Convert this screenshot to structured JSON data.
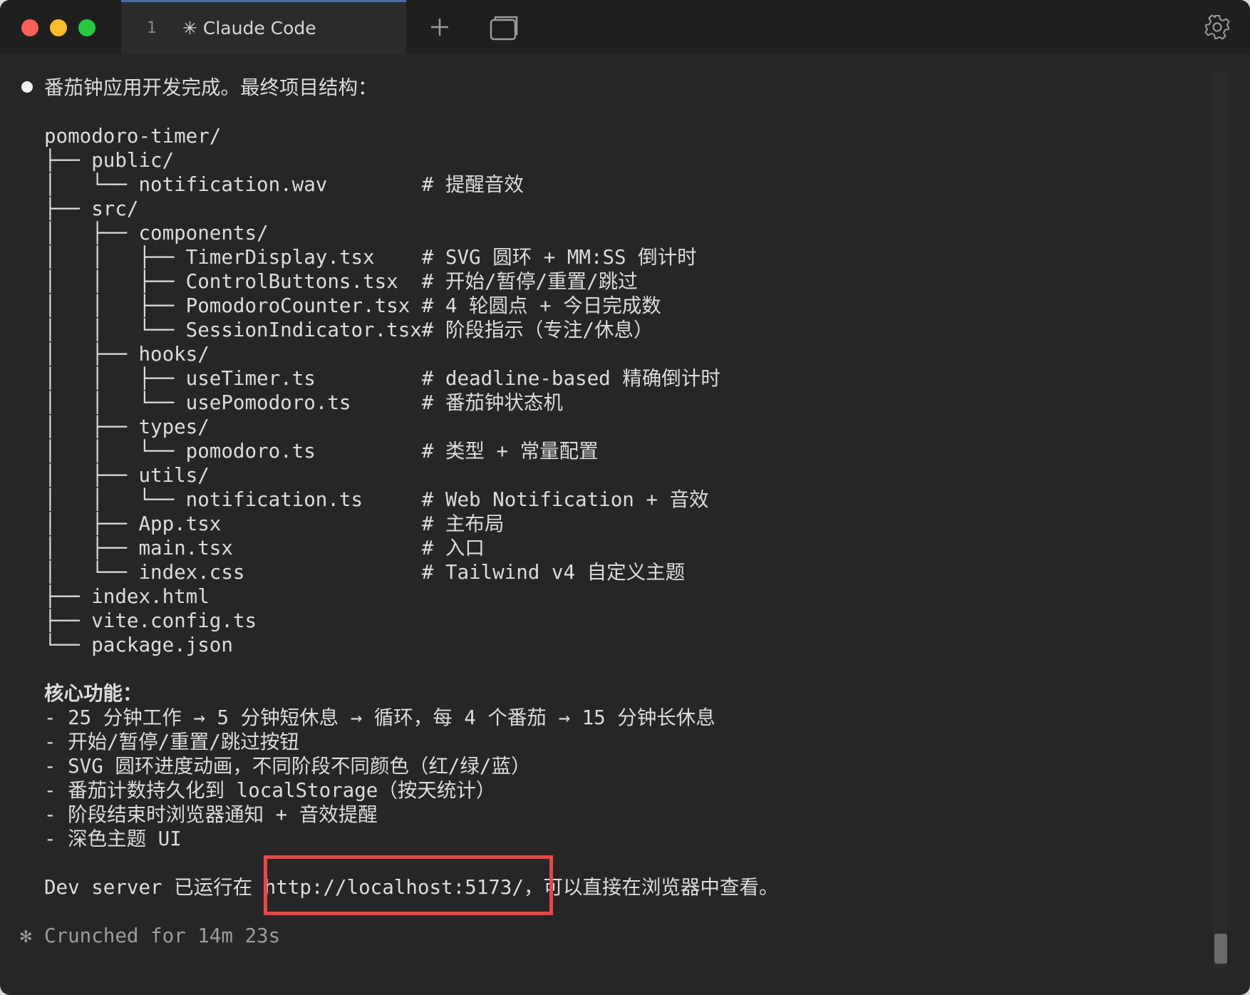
{
  "window": {
    "tab_number": "1",
    "tab_title": "✳ Claude Code"
  },
  "colors": {
    "background": "#262626",
    "text": "#dcdcdc",
    "muted": "#9c9c9c",
    "highlight_border": "#e8474a"
  },
  "terminal": {
    "heading": "番茄钟应用开发完成。最终项目结构：",
    "tree": [
      "pomodoro-timer/",
      "├── public/",
      "│   └── notification.wav        # 提醒音效",
      "├── src/",
      "│   ├── components/",
      "│   │   ├── TimerDisplay.tsx    # SVG 圆环 + MM:SS 倒计时",
      "│   │   ├── ControlButtons.tsx  # 开始/暂停/重置/跳过",
      "│   │   ├── PomodoroCounter.tsx # 4 轮圆点 + 今日完成数",
      "│   │   └── SessionIndicator.tsx# 阶段指示（专注/休息）",
      "│   ├── hooks/",
      "│   │   ├── useTimer.ts         # deadline-based 精确倒计时",
      "│   │   └── usePomodoro.ts      # 番茄钟状态机",
      "│   ├── types/",
      "│   │   └── pomodoro.ts         # 类型 + 常量配置",
      "│   ├── utils/",
      "│   │   └── notification.ts     # Web Notification + 音效",
      "│   ├── App.tsx                 # 主布局",
      "│   ├── main.tsx                # 入口",
      "│   └── index.css               # Tailwind v4 自定义主题",
      "├── index.html",
      "├── vite.config.ts",
      "└── package.json"
    ],
    "features_title": "核心功能：",
    "features": [
      "- 25 分钟工作 → 5 分钟短休息 → 循环，每 4 个番茄 → 15 分钟长休息",
      "- 开始/暂停/重置/跳过按钮",
      "- SVG 圆环进度动画，不同阶段不同颜色（红/绿/蓝）",
      "- 番茄计数持久化到 localStorage（按天统计）",
      "- 阶段结束时浏览器通知 + 音效提醒",
      "- 深色主题 UI"
    ],
    "dev_server_line": "Dev server 已运行在 http://localhost:5173/，可以直接在浏览器中查看。",
    "status_glyph": "✻",
    "status_text": "Crunched for 14m 23s"
  }
}
